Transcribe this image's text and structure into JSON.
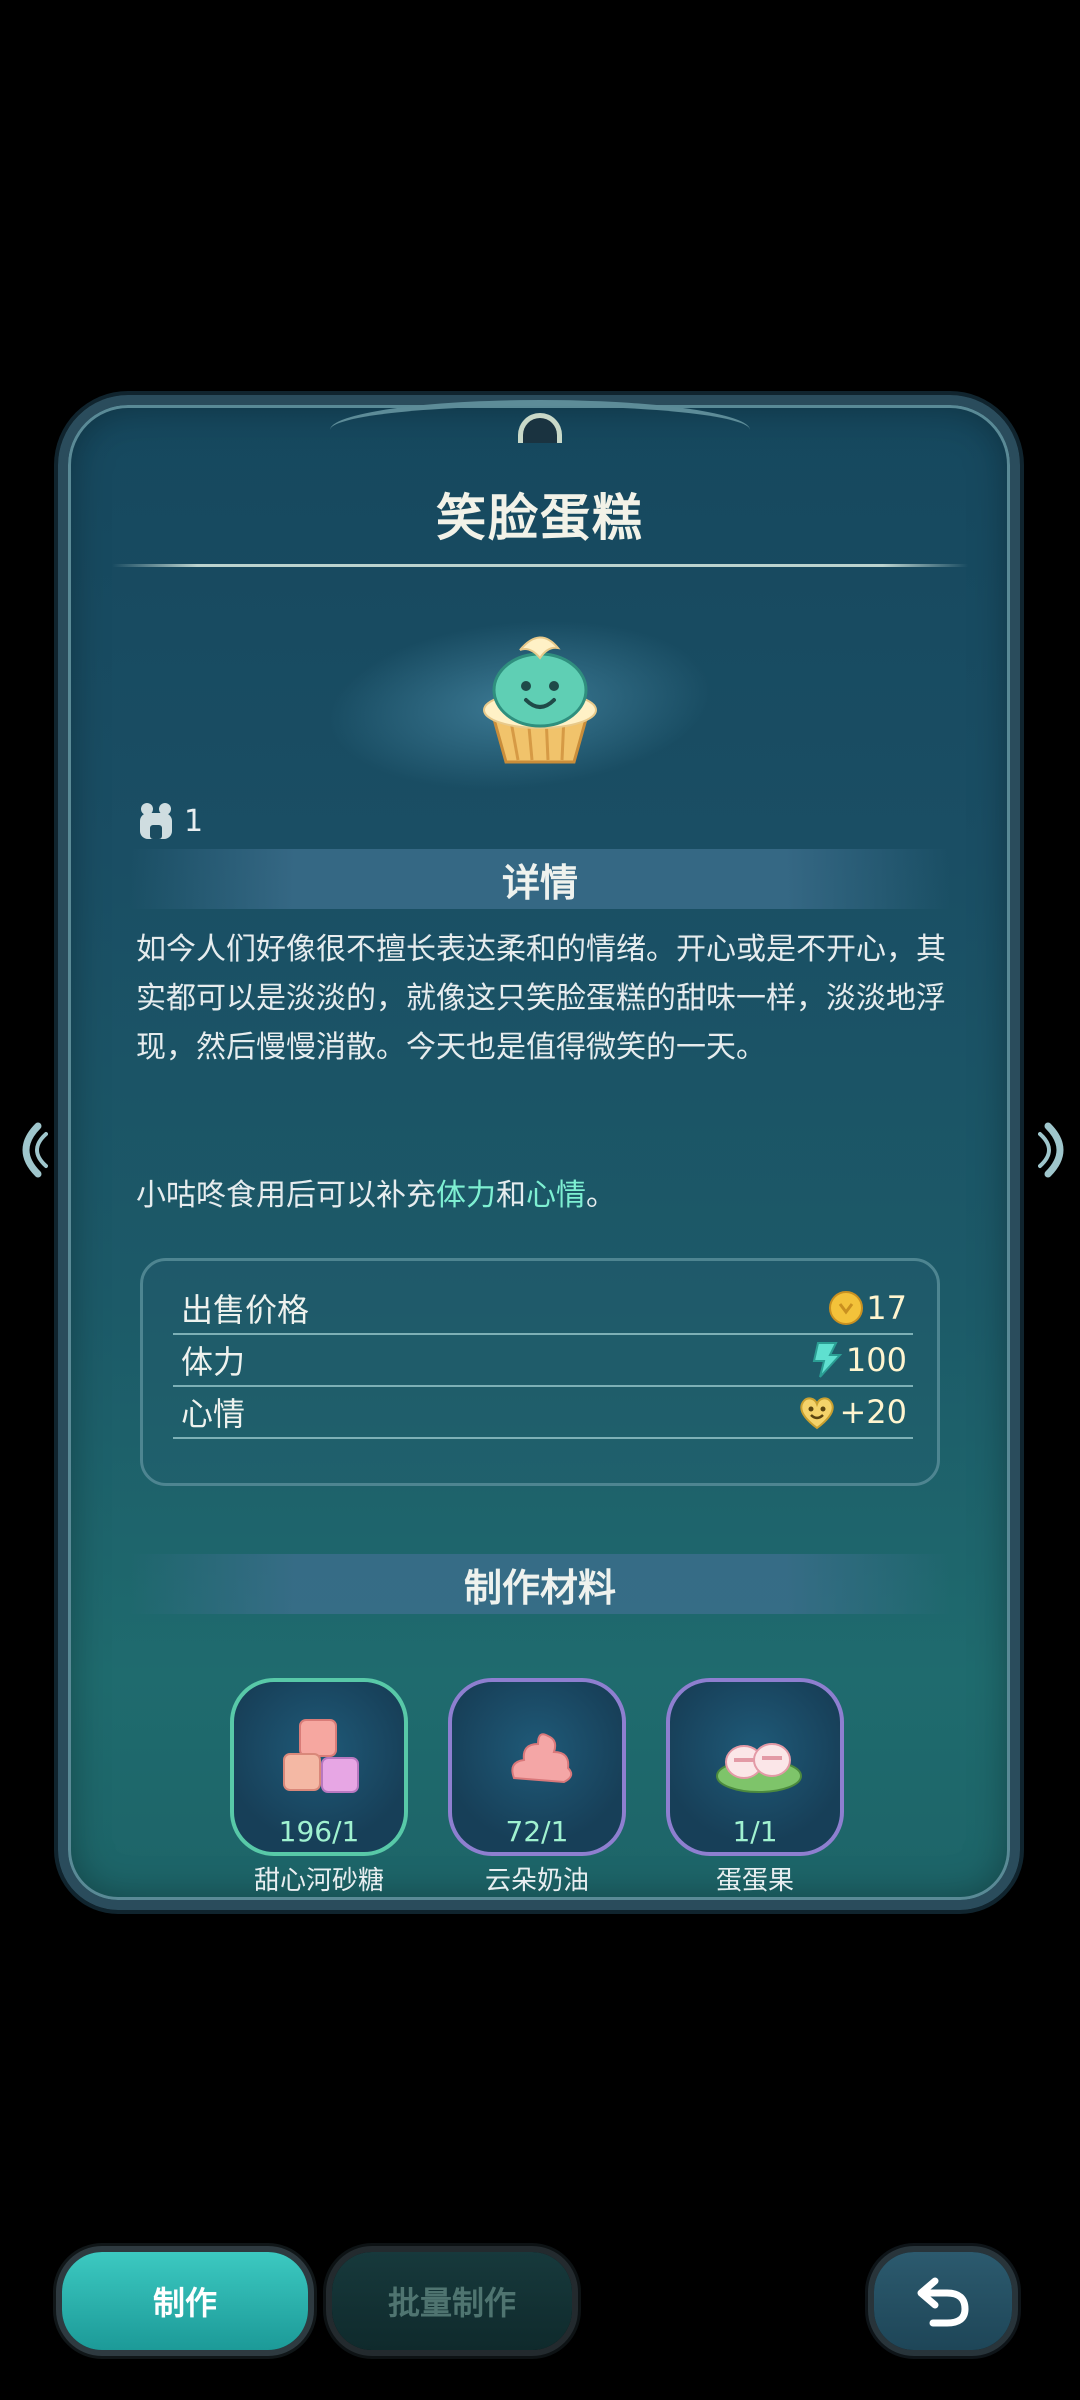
{
  "item": {
    "title": "笑脸蛋糕",
    "owned_count": "1",
    "cake_icon": "smiling-cupcake-icon"
  },
  "details": {
    "heading": "详情",
    "description": "如今人们好像很不擅长表达柔和的情绪。开心或是不开心，其实都可以是淡淡的，就像这只笑脸蛋糕的甜味一样，淡淡地浮现，然后慢慢消散。今天也是值得微笑的一天。",
    "note_prefix": "小咕咚食用后可以补充",
    "note_stamina": "体力",
    "note_and": "和",
    "note_mood": "心情",
    "note_end": "。"
  },
  "stats": [
    {
      "label": "出售价格",
      "value": "17",
      "icon": "coin-icon"
    },
    {
      "label": "体力",
      "value": "100",
      "icon": "lightning-icon"
    },
    {
      "label": "心情",
      "value": "+20",
      "icon": "heart-smile-icon"
    }
  ],
  "materials_heading": "制作材料",
  "materials": [
    {
      "name": "甜心河砂糖",
      "count": "196/1",
      "icon": "sugar-cubes-icon"
    },
    {
      "name": "云朵奶油",
      "count": "72/1",
      "icon": "cream-icon"
    },
    {
      "name": "蛋蛋果",
      "count": "1/1",
      "icon": "egg-fruit-icon"
    }
  ],
  "buttons": {
    "make": "制作",
    "batch_make": "批量制作",
    "back_icon": "undo-arrow-icon"
  },
  "colors": {
    "accent": "#3cc9c1",
    "highlight": "#7ef0d2",
    "card_bg": "#1a4e64",
    "stat_value": "#fff5cf"
  }
}
